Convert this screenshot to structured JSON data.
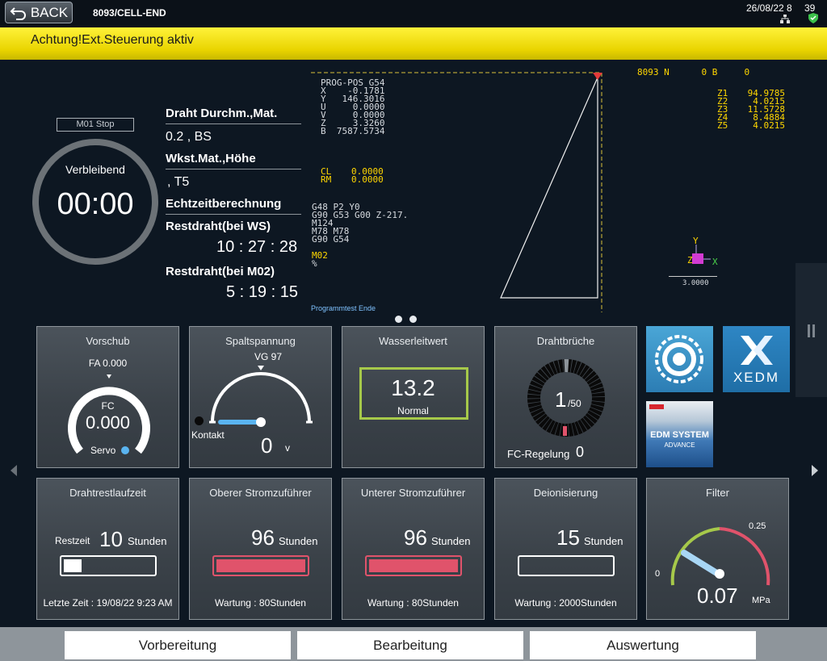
{
  "header": {
    "back_label": "BACK",
    "machine": "8093/CELL-END",
    "date": "26/08/22 8",
    "count": "39"
  },
  "alert": {
    "text": "Achtung!Ext.Steuerung aktiv"
  },
  "timer": {
    "mode": "M01 Stop",
    "label": "Verbleibend",
    "value": "00:00"
  },
  "info": {
    "wire_h": "Draht Durchm.,Mat.",
    "wire_v": "0.2 , BS",
    "work_h": "Wkst.Mat.,Höhe",
    "work_v": ", T5",
    "realtime_h": "Echtzeitberechnung",
    "rest_ws_h": "Restdraht(bei WS)",
    "rest_ws_v": "10 : 27 : 28",
    "rest_m02_h": "Restdraht(bei M02)",
    "rest_m02_v": "5 : 19 : 15"
  },
  "nc": {
    "pos_block": "PROG-POS G54\nX    -0.1781\nY   146.3016\nU     0.0000\nV     0.0000\nZ     3.3260\nB  7587.5734",
    "cl_rm_labels": "CL\nRM",
    "cl_rm_values": "0.0000\n0.0000",
    "program_lines": "G48 P2 Y0\nG90 G53 G00 Z-217.\nM124\nM78 M78\nG90 G54",
    "program_active": "M02",
    "program_pct": "%",
    "program_end": "Programmtest Ende",
    "top_info": "8093 N      0 B     0",
    "z_labels": "Z1\nZ2\nZ3\nZ4\nZ5",
    "z_values": "94.9785\n4.0215\n11.5728\n8.4884\n4.0215",
    "axis_y": "Y",
    "axis_x": "X",
    "axis_z": "Z",
    "scale": "3.0000"
  },
  "tiles_top": {
    "vorschub": {
      "title": "Vorschub",
      "fa": "FA 0.000",
      "fc_label": "FC",
      "fc_value": "0.000",
      "servo": "Servo"
    },
    "spalt": {
      "title": "Spaltspannung",
      "vg": "VG 97",
      "kontakt": "Kontakt",
      "value": "0",
      "unit": "V"
    },
    "wasser": {
      "title": "Wasserleitwert",
      "value": "13.2",
      "status": "Normal"
    },
    "drahtbruch": {
      "title": "Drahtbrüche",
      "value": "1",
      "total": "/50",
      "fc_label": "FC-Regelung",
      "fc_value": "0"
    }
  },
  "logos": {
    "xedm": "XEDM",
    "edm_system": "EDM SYSTEM",
    "edm_sub": "ADVANCE"
  },
  "tiles_bottom": {
    "restlauf": {
      "title": "Drahtrestlaufzeit",
      "prefix": "Restzeit",
      "value": "10",
      "unit": "Stunden",
      "last": "Letzte Zeit : 19/08/22 9:23 AM",
      "fill": 0.2
    },
    "oberer": {
      "title": "Oberer Stromzuführer",
      "value": "96",
      "unit": "Stunden",
      "wartung": "Wartung : 80Stunden",
      "fill": 1.0
    },
    "unterer": {
      "title": "Unterer Stromzuführer",
      "value": "96",
      "unit": "Stunden",
      "wartung": "Wartung : 80Stunden",
      "fill": 1.0
    },
    "deion": {
      "title": "Deionisierung",
      "value": "15",
      "unit": "Stunden",
      "wartung": "Wartung : 2000Stunden",
      "fill": 0.0
    },
    "filter": {
      "title": "Filter",
      "min": "0",
      "max": "0.25",
      "value": "0.07",
      "unit": "MPa"
    }
  },
  "nav": {
    "tab1": "Vorbereitung",
    "tab2": "Bearbeitung",
    "tab3": "Auswertung"
  },
  "colors": {
    "alert_yellow": "#f5e31a",
    "accent_blue": "#5ab4f0",
    "ok_green": "#a6c94a",
    "warn_red": "#e0536b"
  }
}
